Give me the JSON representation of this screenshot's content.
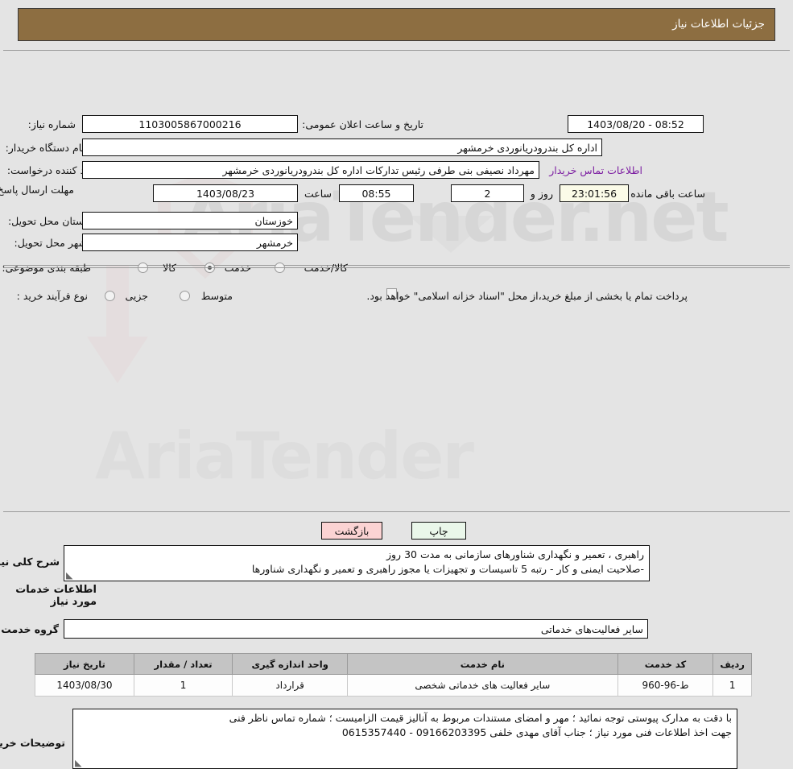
{
  "header": {
    "title": "جزئیات اطلاعات نیاز"
  },
  "watermark": {
    "text1": "AriaTender.net",
    "text2": "AriaTender"
  },
  "form": {
    "need_number": {
      "label": "شماره نیاز:",
      "value": "1103005867000216"
    },
    "public_announce": {
      "label": "تاریخ و ساعت اعلان عمومی:",
      "value": "08:52 - 1403/08/20"
    },
    "buyer_org": {
      "label": "نام دستگاه خریدار:",
      "value": "اداره کل بندرودریانوردی خرمشهر"
    },
    "requester": {
      "label": "ایجاد کننده درخواست:",
      "value": "مهرداد  نصیفی بنی طرفی رئیس تدارکات اداره کل بندرودریانوردی خرمشهر"
    },
    "contact_link": "اطلاعات تماس خریدار",
    "deadline": {
      "label": "مهلت ارسال پاسخ: تا تاریخ:",
      "date": "1403/08/23",
      "time_label": "ساعت",
      "time": "08:55",
      "days": "2",
      "days_label": "روز و",
      "countdown": "23:01:56",
      "remaining_label": "ساعت باقی مانده"
    },
    "province": {
      "label": "استان محل تحویل:",
      "value": "خوزستان"
    },
    "city": {
      "label": "شهر محل تحویل:",
      "value": "خرمشهر"
    },
    "category": {
      "label": "طبقه بندی موضوعی:",
      "options": [
        "کالا",
        "خدمت",
        "کالا/خدمت"
      ],
      "selected": "خدمت"
    },
    "process_type": {
      "label": "نوع فرآیند خرید :",
      "options": [
        "جزیی",
        "متوسط"
      ],
      "selected": "",
      "treasury_checkbox_label": "پرداخت تمام یا بخشی از مبلغ خرید،از محل \"اسناد خزانه اسلامی\" خواهد بود.",
      "treasury_checked": false
    }
  },
  "need_summary": {
    "label": "شرح کلی نیاز:",
    "lines": [
      "راهبری ، تعمیر و نگهداری شناورهای سازمانی به مدت  30 روز",
      "-صلاحیت ایمنی  و کار - رتبه 5 تاسیسات و تجهیزات یا مجوز راهبری و تعمیر و نگهداری شناورها"
    ]
  },
  "services_section": {
    "title": "اطلاعات خدمات مورد نیاز",
    "service_group": {
      "label": "گروه خدمت:",
      "value": "سایر فعالیت‌های خدماتی"
    },
    "table": {
      "columns": [
        "ردیف",
        "کد خدمت",
        "نام خدمت",
        "واحد اندازه گیری",
        "تعداد / مقدار",
        "تاریخ نیاز"
      ],
      "rows": [
        {
          "row": "1",
          "code": "ط-96-960",
          "name": "سایر فعالیت های خدماتی شخصی",
          "unit": "قرارداد",
          "qty": "1",
          "date": "1403/08/30"
        }
      ]
    }
  },
  "buyer_notes": {
    "label": "توضیحات خریدار:",
    "lines": [
      "با دقت به مدارک پیوستی توجه نمائید ؛ مهر و امضای مستندات مربوط به آنالیز قیمت الزامیست ؛  شماره تماس ناظر فنی",
      "جهت اخذ اطلاعات فنی مورد نیاز ؛ جناب آقای  مهدی خلفی   09166203395  -  0615357440"
    ]
  },
  "buttons": {
    "print": "چاپ",
    "back": "بازگشت"
  },
  "colors": {
    "header_brown": "#8d6e41",
    "link_purple": "#7d1fa2",
    "print_green": "#eaf7ea",
    "back_pink": "#fbd3d3",
    "table_header": "#c4c4c4"
  }
}
